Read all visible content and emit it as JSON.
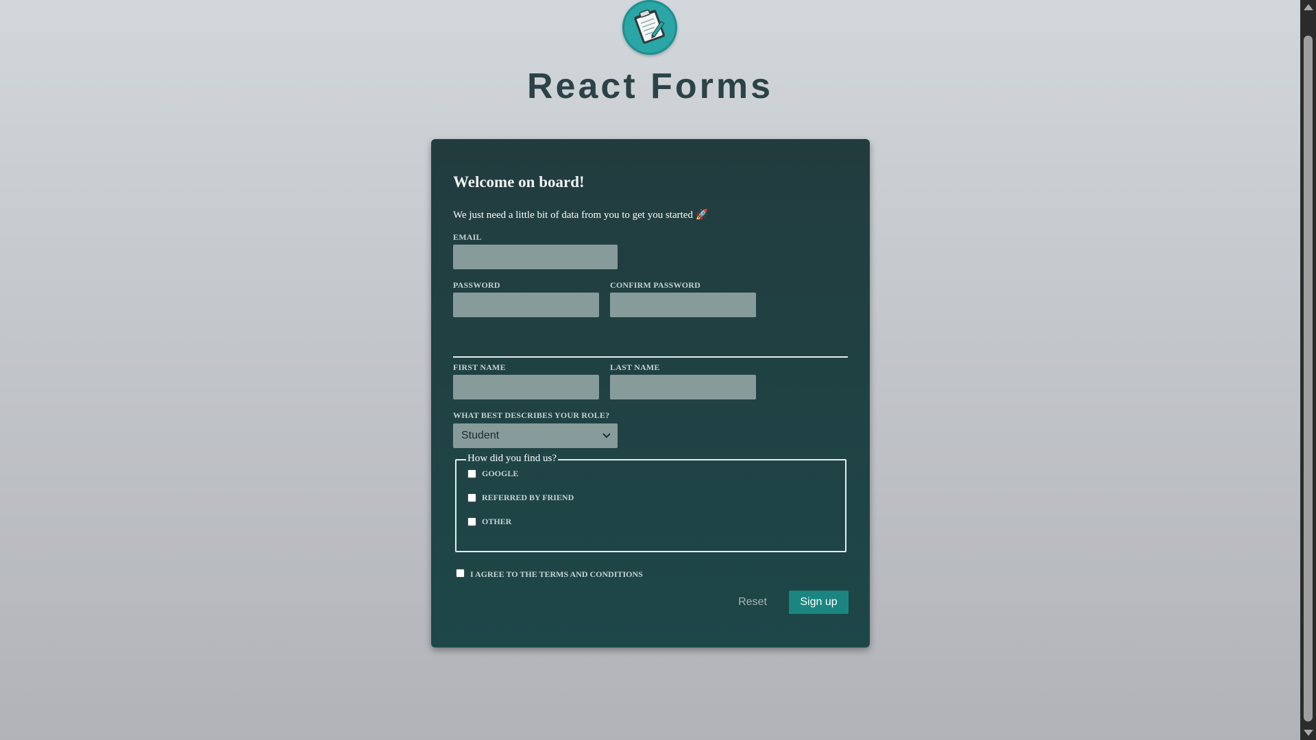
{
  "header": {
    "logo_icon": "clipboard-icon",
    "title": "React Forms"
  },
  "form": {
    "heading": "Welcome on board!",
    "intro": "We just need a little bit of data from you to get you started 🚀",
    "email": {
      "label": "EMAIL",
      "value": ""
    },
    "password": {
      "label": "PASSWORD",
      "value": ""
    },
    "confirm_password": {
      "label": "CONFIRM PASSWORD",
      "value": ""
    },
    "first_name": {
      "label": "FIRST NAME",
      "value": ""
    },
    "last_name": {
      "label": "LAST NAME",
      "value": ""
    },
    "role": {
      "label": "WHAT BEST DESCRIBES YOUR ROLE?",
      "selected": "Student"
    },
    "found_us": {
      "legend": "How did you find us?",
      "options": [
        {
          "label": "GOOGLE",
          "checked": false
        },
        {
          "label": "REFERRED BY FRIEND",
          "checked": false
        },
        {
          "label": "OTHER",
          "checked": false
        }
      ]
    },
    "terms": {
      "label": "I AGREE TO THE TERMS AND CONDITIONS",
      "checked": false
    },
    "reset_label": "Reset",
    "signup_label": "Sign up"
  },
  "colors": {
    "accent": "#1b8681",
    "card": "#1e4748",
    "input_bg": "#879c9a",
    "title": "#2b4346"
  }
}
